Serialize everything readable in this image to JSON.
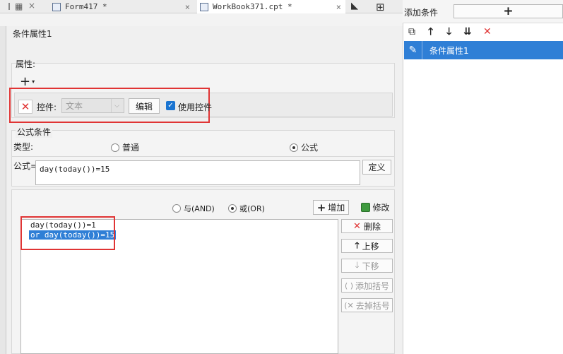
{
  "tabs": [
    {
      "label": "Form417 *",
      "close": "×"
    },
    {
      "label": "WorkBook371.cpt *",
      "close": "×"
    }
  ],
  "dialog": {
    "title": "条件属性1"
  },
  "properties": {
    "section_label": "属性:",
    "add_symbol": "+",
    "control_label": "控件:",
    "control_value": "文本",
    "edit_button": "编辑",
    "use_control_label": "使用控件"
  },
  "formula_condition": {
    "section_label": "公式条件",
    "type_label": "类型:",
    "option_normal": "普通",
    "option_formula": "公式",
    "formula_label": "公式=",
    "formula_value": "day(today())=15",
    "define_button": "定义"
  },
  "logic": {
    "and_label": "与(AND)",
    "or_label": "或(OR)",
    "add_button": "增加",
    "modify_button": "修改"
  },
  "conditions": {
    "line1": "day(today())=1",
    "line2": "or  day(today())=15"
  },
  "side_buttons": {
    "delete": "删除",
    "move_up": "上移",
    "move_down": "下移",
    "add_bracket": "添加括号",
    "remove_bracket": "去掉括号"
  },
  "right_pane": {
    "add_condition_label": "添加条件",
    "add_symbol": "+",
    "selected_item": "条件属性1"
  },
  "colors": {
    "highlight": "#e03434",
    "selection": "#2f7fd6",
    "check": "#1a74d1"
  }
}
